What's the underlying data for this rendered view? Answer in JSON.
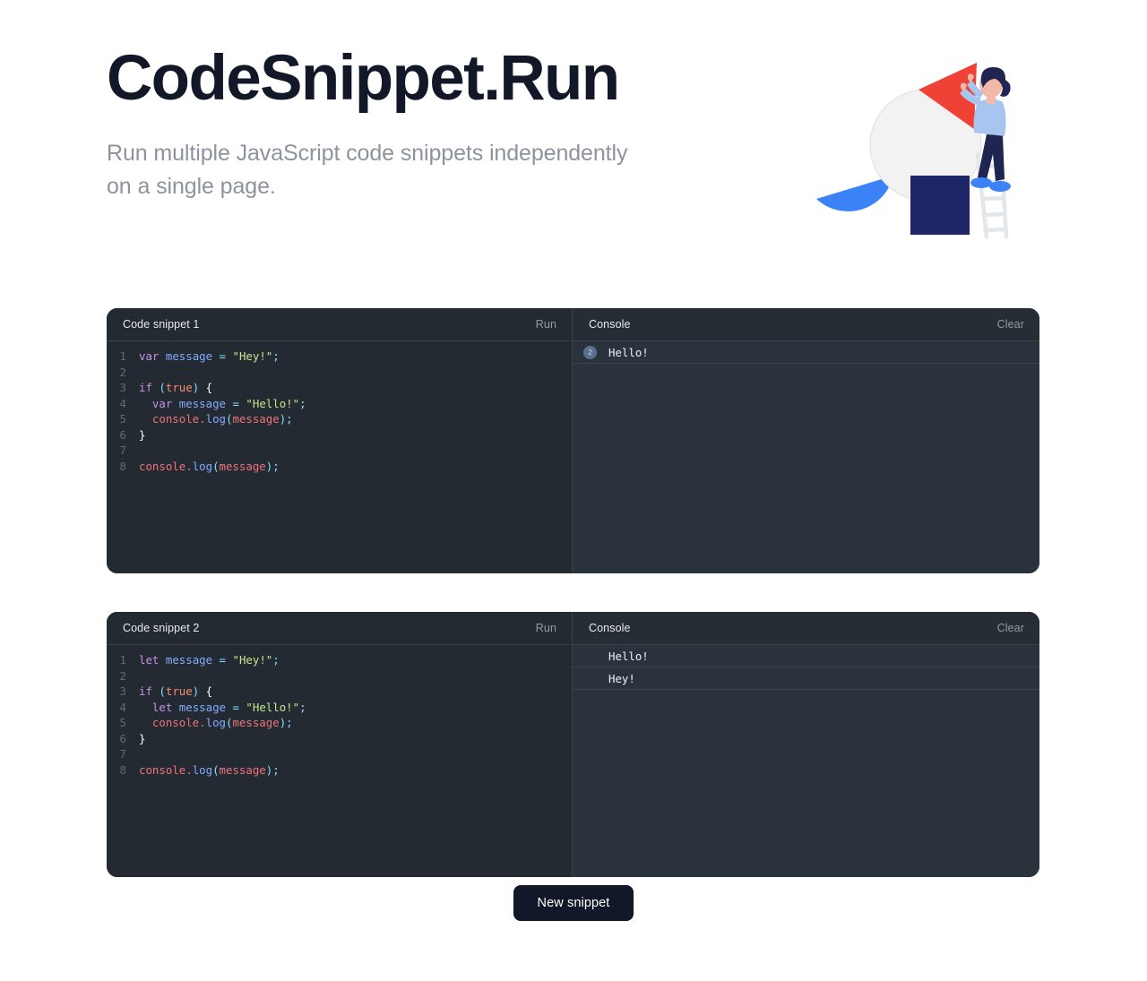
{
  "hero": {
    "title": "CodeSnippet.Run",
    "subtitle": "Run multiple JavaScript code snippets independently on a single page.",
    "illustration_name": "person-on-ladder-stacking-shapes",
    "colors": {
      "title": "#121828",
      "subtitle": "#8d939e",
      "triangle_red": "#ef4136",
      "square_navy": "#1f2667",
      "half_circle_blue": "#3b82f6",
      "circle_white": "#f1f1f1",
      "shirt_blue": "#a8c5f0",
      "hair_navy": "#1f2450",
      "shoes_blue": "#3b82f6",
      "ladder_gray": "#e8eaed"
    }
  },
  "theme": {
    "editor_bg": "#242a32",
    "console_bg": "#2a323b",
    "header_bg": "#242a32",
    "console_header_bg": "#262d35",
    "divider": "#3b444e",
    "badge_bg": "#5b708f",
    "button_bg": "#121828"
  },
  "syntax_colors": {
    "keyword": "#c792ea",
    "variable": "#82aaff",
    "operator": "#89ddff",
    "string": "#c3e88d",
    "boolean": "#f78c6c",
    "object": "#f07178",
    "function": "#82aaff",
    "punctuation": "#89ddff",
    "brace": "#ffffff",
    "line_number": "#616b76"
  },
  "labels": {
    "run": "Run",
    "clear": "Clear",
    "console": "Console",
    "new_snippet": "New snippet"
  },
  "snippets": [
    {
      "title": "Code snippet 1",
      "run_label": "Run",
      "console_label": "Console",
      "clear_label": "Clear",
      "line_count": 8,
      "code_lines": [
        {
          "n": "1",
          "tokens": [
            {
              "t": "var",
              "c": "t-kw"
            },
            {
              "t": " ",
              "c": "t-plain"
            },
            {
              "t": "message",
              "c": "t-var"
            },
            {
              "t": " ",
              "c": "t-plain"
            },
            {
              "t": "=",
              "c": "t-op"
            },
            {
              "t": " ",
              "c": "t-plain"
            },
            {
              "t": "\"Hey!\"",
              "c": "t-str"
            },
            {
              "t": ";",
              "c": "t-punc"
            }
          ]
        },
        {
          "n": "2",
          "tokens": []
        },
        {
          "n": "3",
          "tokens": [
            {
              "t": "if",
              "c": "t-kw"
            },
            {
              "t": " ",
              "c": "t-plain"
            },
            {
              "t": "(",
              "c": "t-punc"
            },
            {
              "t": "true",
              "c": "t-bool"
            },
            {
              "t": ")",
              "c": "t-punc"
            },
            {
              "t": " ",
              "c": "t-plain"
            },
            {
              "t": "{",
              "c": "t-brace"
            }
          ]
        },
        {
          "n": "4",
          "tokens": [
            {
              "t": "  ",
              "c": "t-plain"
            },
            {
              "t": "var",
              "c": "t-kw"
            },
            {
              "t": " ",
              "c": "t-plain"
            },
            {
              "t": "message",
              "c": "t-var"
            },
            {
              "t": " ",
              "c": "t-plain"
            },
            {
              "t": "=",
              "c": "t-op"
            },
            {
              "t": " ",
              "c": "t-plain"
            },
            {
              "t": "\"Hello!\"",
              "c": "t-str"
            },
            {
              "t": ";",
              "c": "t-punc"
            }
          ]
        },
        {
          "n": "5",
          "tokens": [
            {
              "t": "  ",
              "c": "t-plain"
            },
            {
              "t": "console",
              "c": "t-obj"
            },
            {
              "t": ".",
              "c": "t-obj"
            },
            {
              "t": "log",
              "c": "t-fn"
            },
            {
              "t": "(",
              "c": "t-punc"
            },
            {
              "t": "message",
              "c": "t-obj"
            },
            {
              "t": ")",
              "c": "t-punc"
            },
            {
              "t": ";",
              "c": "t-punc"
            }
          ]
        },
        {
          "n": "6",
          "tokens": [
            {
              "t": "}",
              "c": "t-brace"
            }
          ]
        },
        {
          "n": "7",
          "tokens": []
        },
        {
          "n": "8",
          "tokens": [
            {
              "t": "console",
              "c": "t-obj"
            },
            {
              "t": ".",
              "c": "t-obj"
            },
            {
              "t": "log",
              "c": "t-fn"
            },
            {
              "t": "(",
              "c": "t-punc"
            },
            {
              "t": "message",
              "c": "t-obj"
            },
            {
              "t": ")",
              "c": "t-punc"
            },
            {
              "t": ";",
              "c": "t-punc"
            }
          ]
        }
      ],
      "console_rows": [
        {
          "badge": "2",
          "message": "Hello!"
        }
      ]
    },
    {
      "title": "Code snippet 2",
      "run_label": "Run",
      "console_label": "Console",
      "clear_label": "Clear",
      "line_count": 8,
      "code_lines": [
        {
          "n": "1",
          "tokens": [
            {
              "t": "let",
              "c": "t-kw"
            },
            {
              "t": " ",
              "c": "t-plain"
            },
            {
              "t": "message",
              "c": "t-var"
            },
            {
              "t": " ",
              "c": "t-plain"
            },
            {
              "t": "=",
              "c": "t-op"
            },
            {
              "t": " ",
              "c": "t-plain"
            },
            {
              "t": "\"Hey!\"",
              "c": "t-str"
            },
            {
              "t": ";",
              "c": "t-punc"
            }
          ]
        },
        {
          "n": "2",
          "tokens": []
        },
        {
          "n": "3",
          "tokens": [
            {
              "t": "if",
              "c": "t-kw"
            },
            {
              "t": " ",
              "c": "t-plain"
            },
            {
              "t": "(",
              "c": "t-punc"
            },
            {
              "t": "true",
              "c": "t-bool"
            },
            {
              "t": ")",
              "c": "t-punc"
            },
            {
              "t": " ",
              "c": "t-plain"
            },
            {
              "t": "{",
              "c": "t-brace"
            }
          ]
        },
        {
          "n": "4",
          "tokens": [
            {
              "t": "  ",
              "c": "t-plain"
            },
            {
              "t": "let",
              "c": "t-kw"
            },
            {
              "t": " ",
              "c": "t-plain"
            },
            {
              "t": "message",
              "c": "t-var"
            },
            {
              "t": " ",
              "c": "t-plain"
            },
            {
              "t": "=",
              "c": "t-op"
            },
            {
              "t": " ",
              "c": "t-plain"
            },
            {
              "t": "\"Hello!\"",
              "c": "t-str"
            },
            {
              "t": ";",
              "c": "t-punc"
            }
          ]
        },
        {
          "n": "5",
          "tokens": [
            {
              "t": "  ",
              "c": "t-plain"
            },
            {
              "t": "console",
              "c": "t-obj"
            },
            {
              "t": ".",
              "c": "t-obj"
            },
            {
              "t": "log",
              "c": "t-fn"
            },
            {
              "t": "(",
              "c": "t-punc"
            },
            {
              "t": "message",
              "c": "t-obj"
            },
            {
              "t": ")",
              "c": "t-punc"
            },
            {
              "t": ";",
              "c": "t-punc"
            }
          ]
        },
        {
          "n": "6",
          "tokens": [
            {
              "t": "}",
              "c": "t-brace"
            }
          ]
        },
        {
          "n": "7",
          "tokens": []
        },
        {
          "n": "8",
          "tokens": [
            {
              "t": "console",
              "c": "t-obj"
            },
            {
              "t": ".",
              "c": "t-obj"
            },
            {
              "t": "log",
              "c": "t-fn"
            },
            {
              "t": "(",
              "c": "t-punc"
            },
            {
              "t": "message",
              "c": "t-obj"
            },
            {
              "t": ")",
              "c": "t-punc"
            },
            {
              "t": ";",
              "c": "t-punc"
            }
          ]
        }
      ],
      "console_rows": [
        {
          "badge": "",
          "message": "Hello!"
        },
        {
          "badge": "",
          "message": "Hey!"
        }
      ]
    }
  ]
}
